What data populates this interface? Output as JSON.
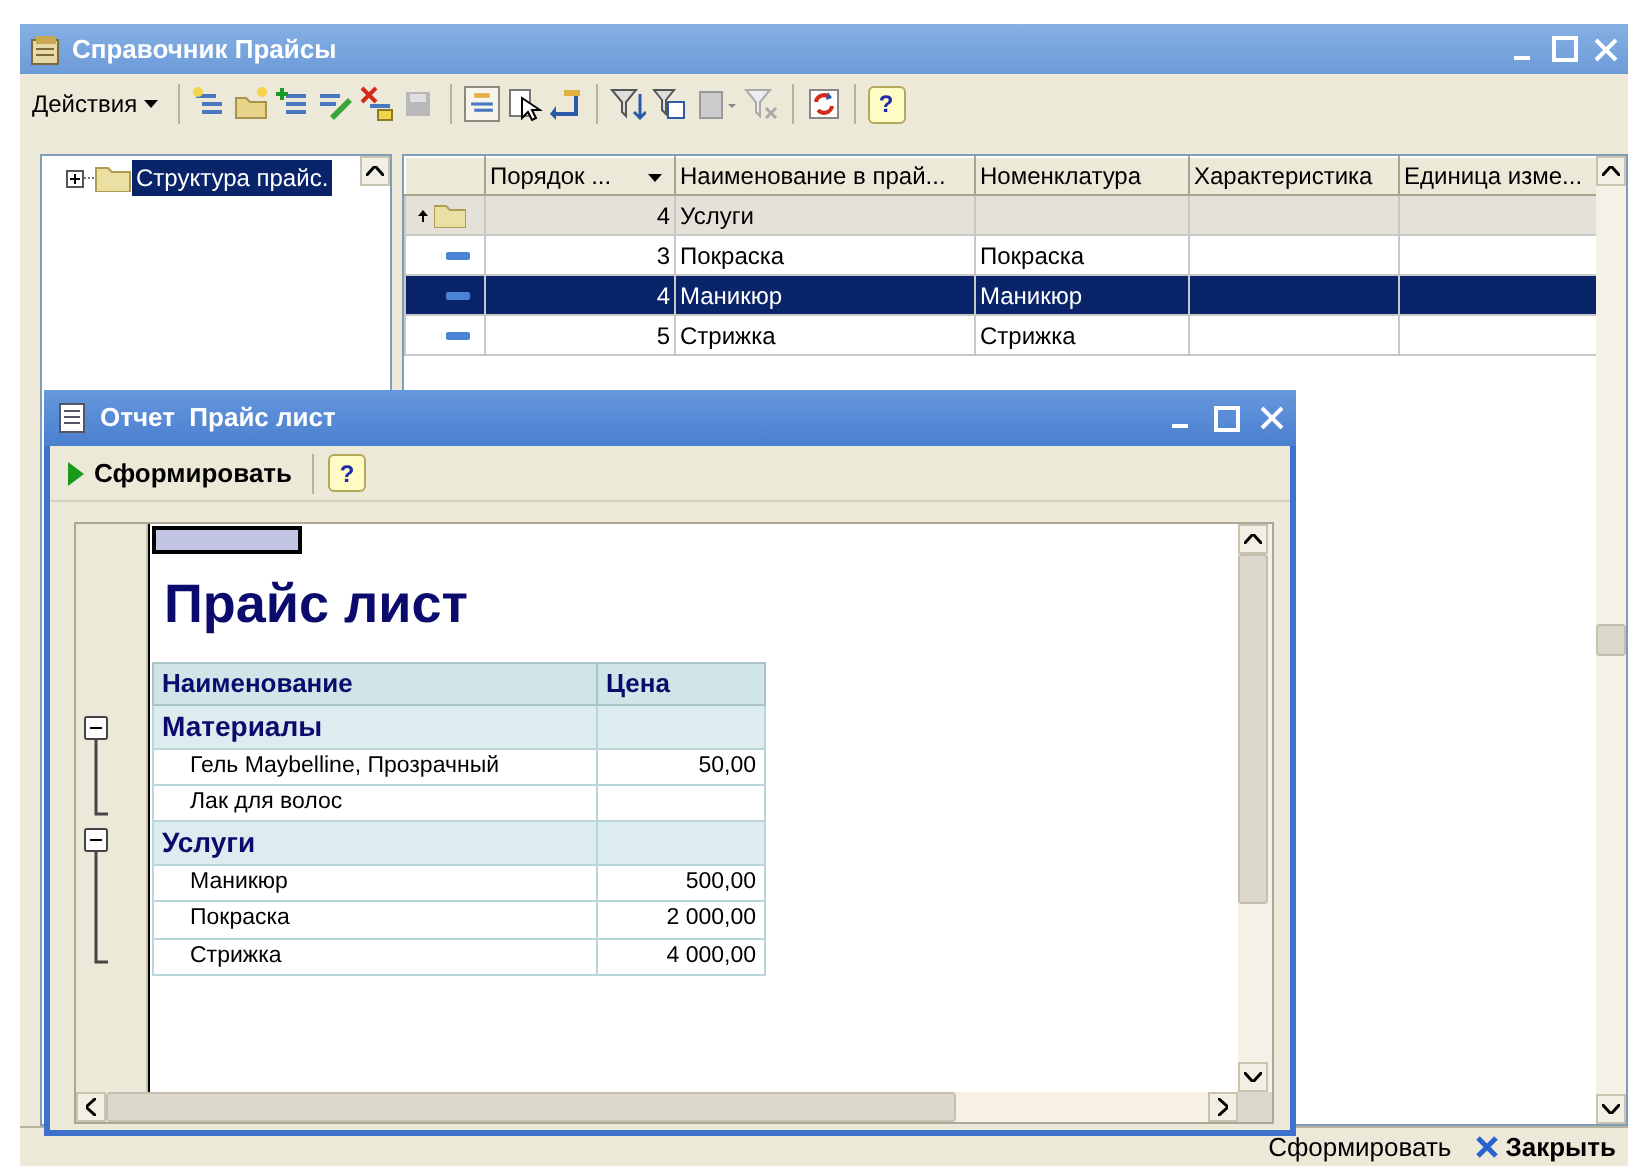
{
  "window": {
    "title": "Справочник Прайсы"
  },
  "toolbar": {
    "actions_menu": "Действия",
    "help_button": "?"
  },
  "tree": {
    "items": [
      {
        "label": "Структура прайс.",
        "expanded": false,
        "selected": true
      }
    ]
  },
  "table": {
    "columns": [
      "Порядок ...",
      "Наименование в прай...",
      "Номенклатура",
      "Характеристика",
      "Единица изме..."
    ],
    "rows": [
      {
        "kind": "group",
        "order": "4",
        "name": "Услуги",
        "selected": false
      },
      {
        "kind": "item",
        "order": "3",
        "name": "Покраска",
        "nomenclature": "Покраска",
        "selected": false
      },
      {
        "kind": "item",
        "order": "4",
        "name": "Маникюр",
        "nomenclature": "Маникюр",
        "selected": true
      },
      {
        "kind": "item",
        "order": "5",
        "name": "Стрижка",
        "nomenclature": "Стрижка",
        "selected": false
      }
    ]
  },
  "report_window": {
    "title": "Отчет  Прайс лист",
    "generate_button": "Сформировать",
    "help_button": "?",
    "report": {
      "title": "Прайс лист",
      "columns": [
        "Наименование",
        "Цена"
      ],
      "groups": [
        {
          "name": "Материалы",
          "expanded": true,
          "items": [
            {
              "name": "Гель Maybelline, Прозрачный",
              "price": "50,00"
            },
            {
              "name": "Лак для волос"
            }
          ]
        },
        {
          "name": "Услуги",
          "expanded": true,
          "items": [
            {
              "name": "Маникюр",
              "price": "500,00"
            },
            {
              "name": "Покраска",
              "price": "2 000,00"
            },
            {
              "name": "Стрижка",
              "price": "4 000,00"
            }
          ]
        }
      ]
    }
  },
  "footer": {
    "buttons": [
      {
        "label": "Сформировать",
        "kind": "plain"
      },
      {
        "label": "Закрыть",
        "kind": "close"
      }
    ]
  }
}
